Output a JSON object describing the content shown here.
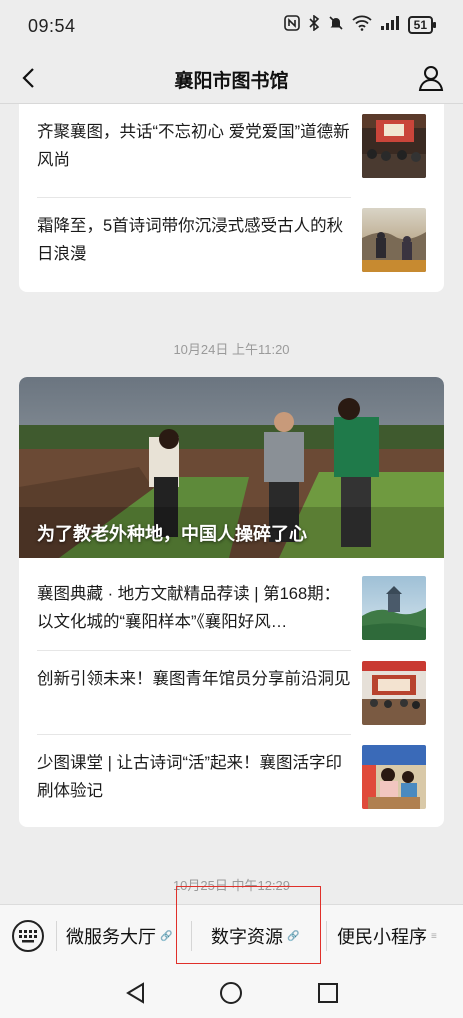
{
  "status_bar": {
    "time": "09:54",
    "battery": "51",
    "icons": [
      "nfc-icon",
      "bluetooth-icon",
      "mute-icon",
      "wifi-icon",
      "signal-icon"
    ]
  },
  "nav": {
    "title": "襄阳市图书馆",
    "back_icon": "chevron-left-icon",
    "profile_icon": "user-icon"
  },
  "feed": {
    "group1": {
      "items": [
        {
          "title": "齐聚襄图，共话“不忘初心 爱党爱国”道德新风尚"
        },
        {
          "title": "霜降至，5首诗词带你沉浸式感受古人的秋日浪漫"
        }
      ]
    },
    "date2": "10月24日 上午11:20",
    "group2": {
      "hero_title": "为了教老外种地，中国人操碎了心",
      "items": [
        {
          "title": "襄图典藏 · 地方文献精品荐读 | 第168期：以文化城的“襄阳样本”《襄阳好风…"
        },
        {
          "title": "创新引领未来！襄图青年馆员分享前沿洞见"
        },
        {
          "title": "少图课堂 | 让古诗词“活”起来！襄图活字印刷体验记"
        }
      ]
    },
    "date3": "10月25日 中午12:29"
  },
  "menu_bar": {
    "keyboard_icon": "keyboard-icon",
    "items": [
      {
        "label": "微服务大厅",
        "suffix": "🔗"
      },
      {
        "label": "数字资源",
        "suffix": "🔗"
      },
      {
        "label": "便民小程序",
        "suffix": "≡"
      }
    ]
  },
  "system_nav": {
    "back": "back-triangle-icon",
    "home": "home-circle-icon",
    "recents": "recents-square-icon"
  },
  "colors": {
    "background": "#ededed",
    "card": "#ffffff",
    "highlight": "#e0302a"
  }
}
